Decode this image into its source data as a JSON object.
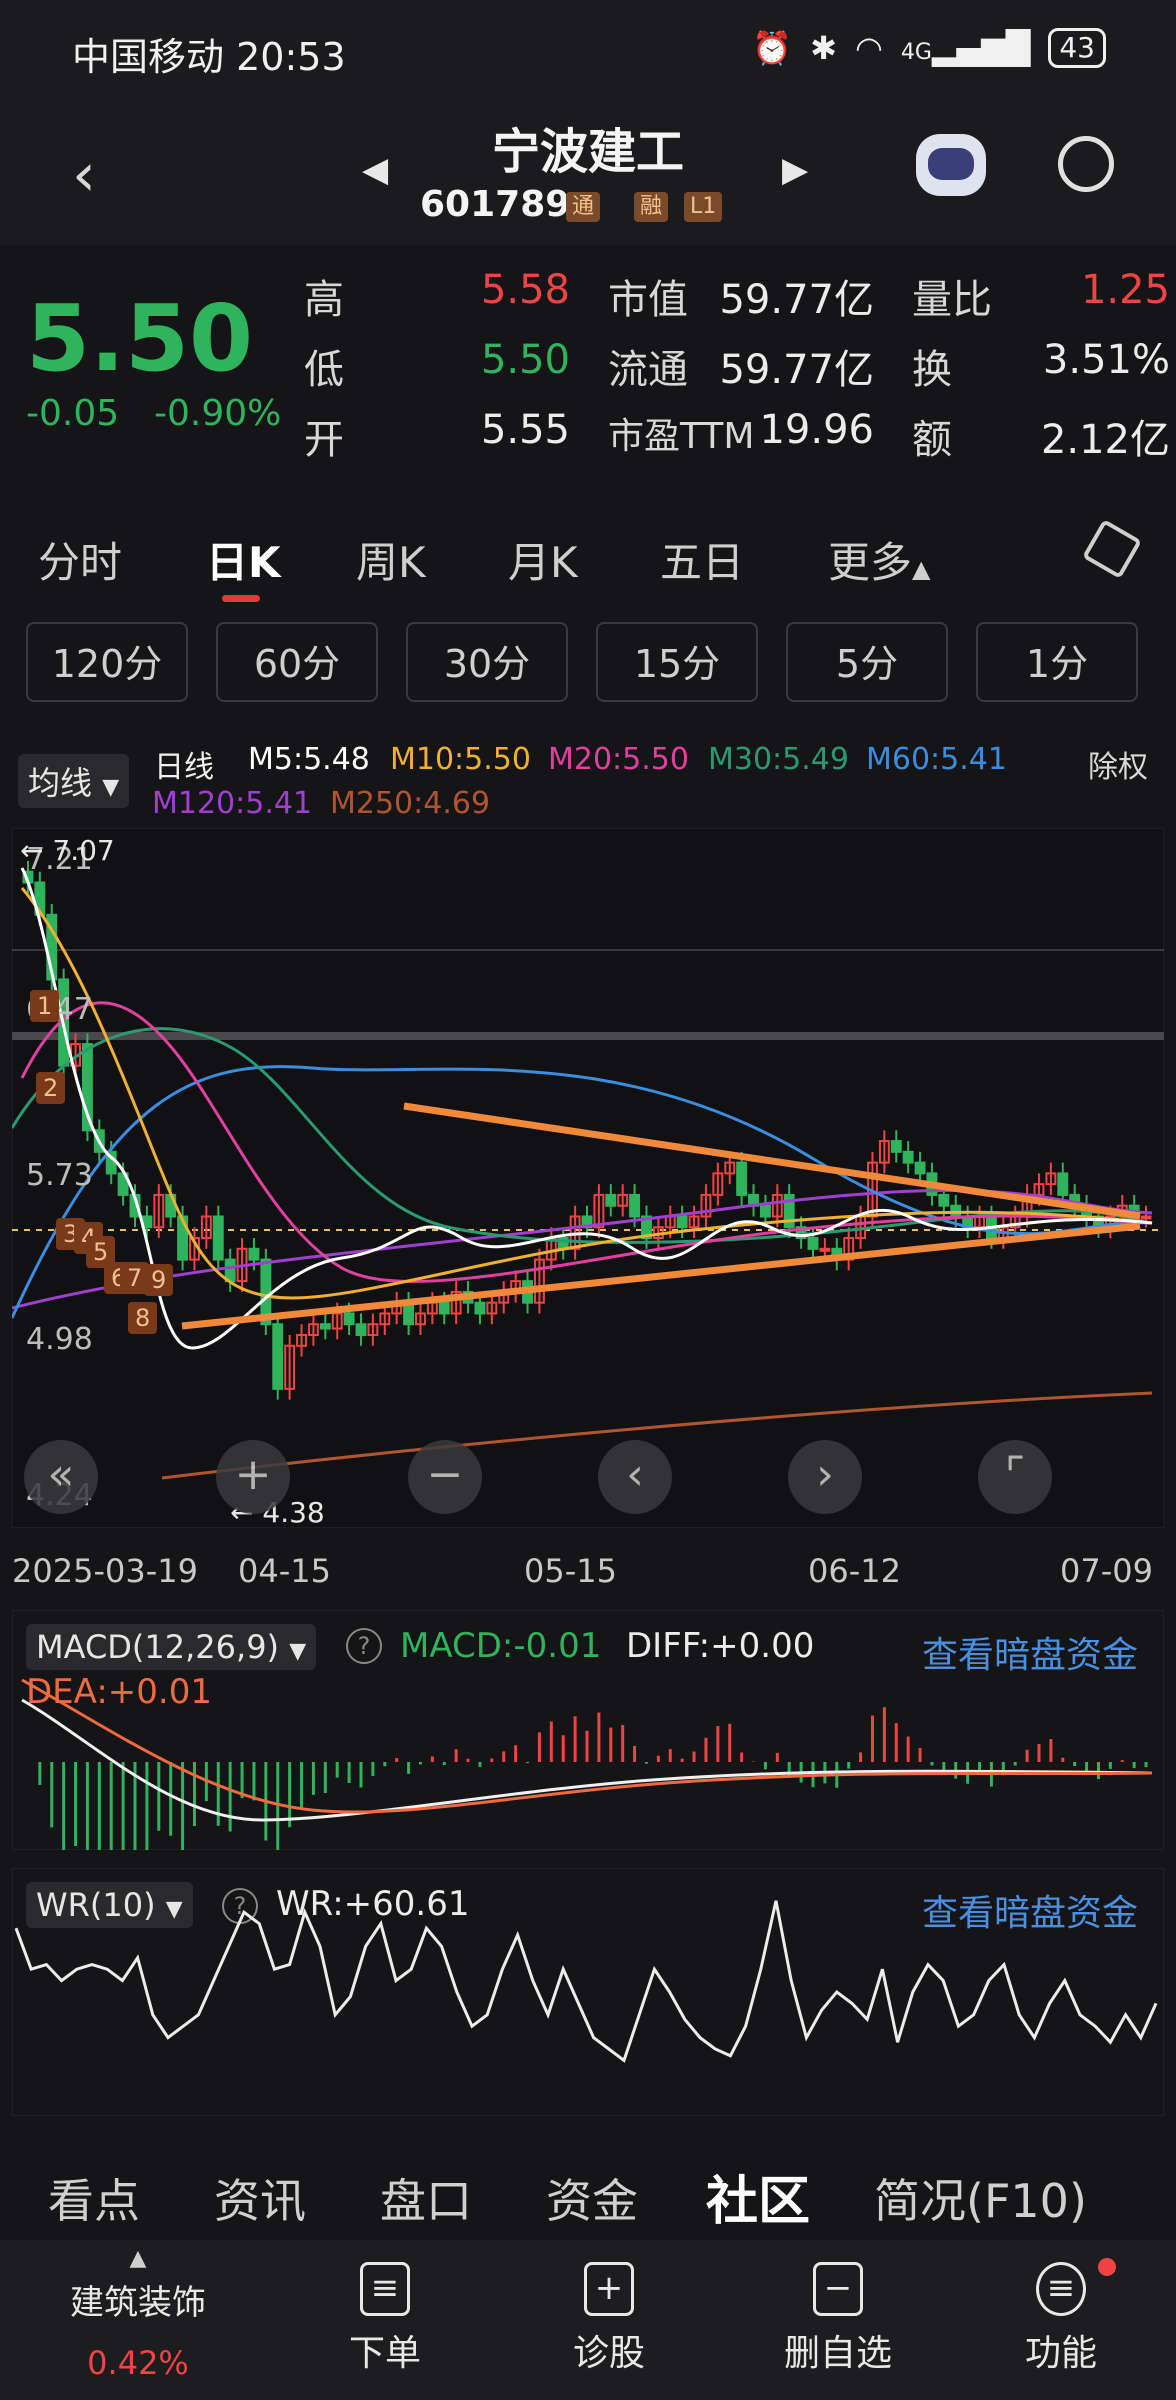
{
  "status_bar": {
    "carrier": "中国移动",
    "time": "20:53",
    "signal": "4G",
    "battery": "43"
  },
  "header": {
    "title": "宁波建工",
    "code": "601789",
    "tags": [
      "通",
      "融",
      "L1"
    ]
  },
  "quote": {
    "price": "5.50",
    "change": "-0.05",
    "change_pct": "-0.90%",
    "high_label": "高",
    "high": "5.58",
    "low_label": "低",
    "low": "5.50",
    "open_label": "开",
    "open": "5.55",
    "mcap_label": "市值",
    "mcap": "59.77亿",
    "float_label": "流通",
    "float": "59.77亿",
    "pe_label": "市盈TTM",
    "pe": "19.96",
    "vol_ratio_label": "量比",
    "vol_ratio": "1.25",
    "turnover_label": "换",
    "turnover": "3.51%",
    "amount_label": "额",
    "amount": "2.12亿"
  },
  "period_tabs": [
    "分时",
    "日K",
    "周K",
    "月K",
    "五日",
    "更多"
  ],
  "active_tab": "日K",
  "minute_pills": [
    "120分",
    "60分",
    "30分",
    "15分",
    "5分",
    "1分"
  ],
  "ma_legend": {
    "selector": "均线",
    "period": "日线",
    "m5": "M5:5.48",
    "m10": "M10:5.50",
    "m20": "M20:5.50",
    "m30": "M30:5.49",
    "m60": "M60:5.41",
    "m120": "M120:5.41",
    "m250": "M250:4.69",
    "adjust": "除权"
  },
  "colors": {
    "up": "#ee4444",
    "down": "#2fb35c",
    "m5": "#ffffff",
    "m10": "#f0b030",
    "m20": "#e040a0",
    "m30": "#2a9a70",
    "m60": "#3b8de0",
    "m120": "#a040d0",
    "m250": "#b05530",
    "trend": "#f08a3a"
  },
  "kchart": {
    "y_labels": [
      "7.21",
      "6.47",
      "5.73",
      "4.98",
      "4.24"
    ],
    "max_label": "7.07",
    "min_label": "4.38",
    "x_labels": [
      "2025-03-19",
      "04-15",
      "05-15",
      "06-12",
      "07-09"
    ],
    "markers": [
      "1",
      "2",
      "3",
      "4",
      "5",
      "6",
      "7",
      "9",
      "8"
    ]
  },
  "chart_data": [
    {
      "type": "candlestick",
      "title": "日K",
      "ylim": [
        4.24,
        7.21
      ],
      "x_labels": [
        "2025-03-19",
        "04-15",
        "05-15",
        "06-12",
        "07-09"
      ],
      "closes": [
        7.05,
        6.9,
        6.6,
        6.2,
        6.3,
        5.9,
        5.8,
        5.7,
        5.6,
        5.5,
        5.45,
        5.6,
        5.5,
        5.3,
        5.4,
        5.5,
        5.3,
        5.2,
        5.35,
        5.3,
        5.0,
        4.7,
        4.9,
        4.95,
        5.0,
        4.98,
        5.05,
        5.0,
        4.95,
        5.0,
        5.05,
        5.1,
        5.0,
        5.05,
        5.1,
        5.05,
        5.15,
        5.1,
        5.05,
        5.1,
        5.15,
        5.2,
        5.1,
        5.3,
        5.4,
        5.35,
        5.5,
        5.45,
        5.6,
        5.55,
        5.6,
        5.5,
        5.4,
        5.45,
        5.5,
        5.45,
        5.5,
        5.6,
        5.7,
        5.75,
        5.6,
        5.55,
        5.5,
        5.6,
        5.45,
        5.4,
        5.35,
        5.35,
        5.3,
        5.4,
        5.5,
        5.75,
        5.85,
        5.8,
        5.75,
        5.7,
        5.6,
        5.55,
        5.5,
        5.45,
        5.5,
        5.4,
        5.45,
        5.5,
        5.6,
        5.65,
        5.7,
        5.6,
        5.55,
        5.5,
        5.45,
        5.5,
        5.55,
        5.5,
        5.5
      ],
      "series": [
        {
          "name": "MACD",
          "value": -0.01
        },
        {
          "name": "DIFF",
          "value": 0.0
        },
        {
          "name": "DEA",
          "value": 0.01
        }
      ]
    },
    {
      "type": "line",
      "title": "WR(10)",
      "ylim": [
        0,
        100
      ],
      "values": [
        78,
        60,
        62,
        55,
        60,
        62,
        60,
        55,
        65,
        40,
        30,
        35,
        40,
        55,
        70,
        85,
        80,
        60,
        62,
        85,
        70,
        40,
        48,
        70,
        80,
        55,
        60,
        78,
        70,
        50,
        35,
        40,
        60,
        75,
        55,
        40,
        60,
        45,
        30,
        25,
        20,
        40,
        60,
        50,
        38,
        30,
        25,
        22,
        35,
        60,
        90,
        55,
        30,
        42,
        50,
        45,
        38,
        60,
        28,
        50,
        62,
        55,
        35,
        40,
        55,
        62,
        40,
        30,
        45,
        55,
        40,
        35,
        28,
        40,
        30,
        45
      ]
    }
  ],
  "macd": {
    "selector": "MACD(12,26,9)",
    "macd": "MACD:-0.01",
    "diff": "DIFF:+0.00",
    "dea": "DEA:+0.01",
    "link": "查看暗盘资金"
  },
  "wr": {
    "selector": "WR(10)",
    "value": "WR:+60.61",
    "link": "查看暗盘资金"
  },
  "bottom_tabs": [
    "看点",
    "资讯",
    "盘口",
    "资金",
    "社区",
    "简况(F10)"
  ],
  "active_bottom_tab": "社区",
  "nav": {
    "sector": "建筑装饰",
    "sector_pct": "0.42%",
    "items": [
      "下单",
      "诊股",
      "删自选",
      "功能"
    ]
  }
}
